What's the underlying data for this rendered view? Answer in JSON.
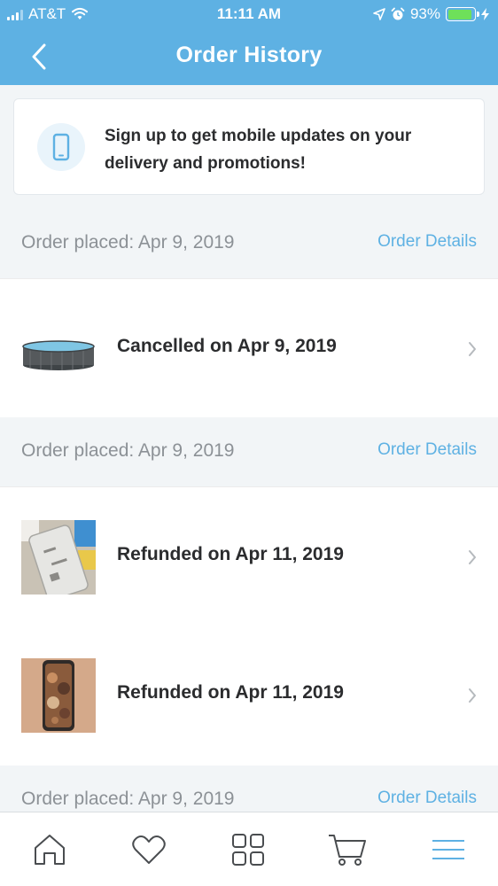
{
  "status_bar": {
    "carrier": "AT&T",
    "time": "11:11 AM",
    "battery_percent": "93%",
    "battery_level": 0.93
  },
  "nav": {
    "title": "Order History"
  },
  "promo": {
    "text": "Sign up to get mobile updates on your delivery and promotions!"
  },
  "orders": [
    {
      "placed": "Order placed: Apr 9, 2019",
      "details_link": "Order Details",
      "items": [
        {
          "status": "Cancelled on Apr 9, 2019"
        }
      ]
    },
    {
      "placed": "Order placed: Apr 9, 2019",
      "details_link": "Order Details",
      "items": [
        {
          "status": "Refunded on Apr 11, 2019"
        },
        {
          "status": "Refunded on Apr 11, 2019"
        }
      ]
    },
    {
      "placed": "Order placed: Apr 9, 2019",
      "details_link": "Order Details",
      "items": []
    }
  ],
  "tab_bar": {
    "tabs": [
      "home-icon",
      "heart-icon",
      "grid-icon",
      "cart-icon",
      "menu-icon"
    ],
    "active_tab": "menu-icon"
  },
  "colors": {
    "header": "#5eb1e3",
    "accent": "#5eb1e3",
    "background": "#f2f5f7"
  }
}
